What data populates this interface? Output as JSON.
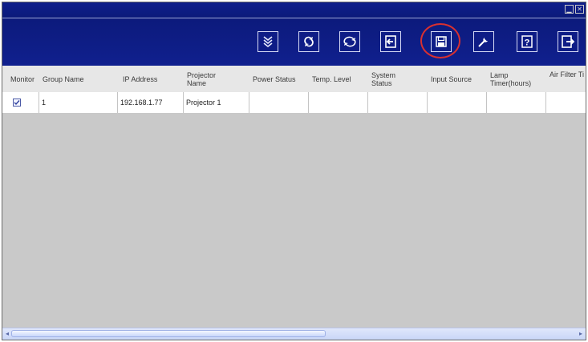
{
  "window": {
    "title_buttons": [
      "minimize-icon",
      "close-icon"
    ]
  },
  "toolbar": {
    "buttons": [
      {
        "name": "collapse-icon"
      },
      {
        "name": "refresh-icon"
      },
      {
        "name": "refresh-all-icon"
      },
      {
        "name": "import-icon"
      },
      {
        "name": "save-icon",
        "highlighted": true
      },
      {
        "name": "settings-icon"
      },
      {
        "name": "help-icon"
      },
      {
        "name": "exit-icon"
      }
    ],
    "accent_color": "#0c1a7c",
    "highlight_color": "#d93030"
  },
  "table": {
    "headers": {
      "monitor": "Monitor",
      "group_name": "Group Name",
      "ip_address": "IP Address",
      "projector_name": "Projector Name",
      "power_status": "Power Status",
      "temp_level": "Temp. Level",
      "system_status": "System Status",
      "input_source": "Input Source",
      "lamp_timer": "Lamp Timer(hours)",
      "air_filter": "Air Filter Ti (hours)"
    },
    "row": {
      "monitor_checked": true,
      "group_name": "1",
      "ip_address": "192.168.1.77",
      "projector_name": "Projector 1",
      "power_status": "",
      "temp_level": "",
      "system_status": "",
      "input_source": "",
      "lamp_timer": "",
      "air_filter": ""
    }
  }
}
